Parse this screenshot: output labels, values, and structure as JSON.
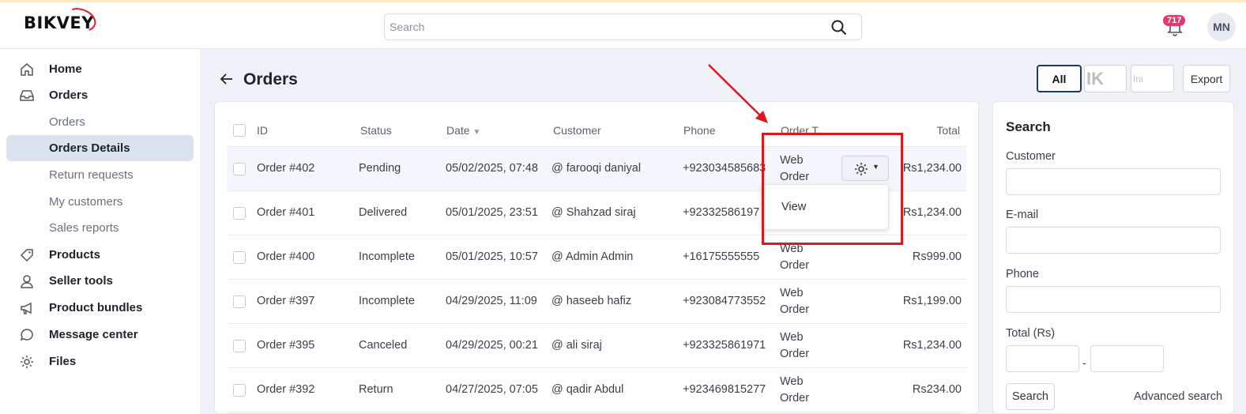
{
  "app": {
    "logo": "BIKVEY",
    "brand_color": "#e31b23"
  },
  "search": {
    "placeholder": "Search"
  },
  "notifications": {
    "count": "717"
  },
  "user": {
    "initials": "MN"
  },
  "sidebar": {
    "items": [
      {
        "label": "Home",
        "icon": "home-icon"
      },
      {
        "label": "Orders",
        "icon": "inbox-icon"
      },
      {
        "label": "Orders"
      },
      {
        "label": "Orders Details",
        "active": true
      },
      {
        "label": "Return requests"
      },
      {
        "label": "My customers"
      },
      {
        "label": "Sales reports"
      },
      {
        "label": "Products",
        "icon": "tag-icon"
      },
      {
        "label": "Seller tools",
        "icon": "user-icon"
      },
      {
        "label": "Product bundles",
        "icon": "megaphone-icon"
      },
      {
        "label": "Message center",
        "icon": "chat-icon"
      },
      {
        "label": "Files",
        "icon": "gear-icon"
      }
    ]
  },
  "page": {
    "title": "Orders"
  },
  "toolbar": {
    "all_label": "All",
    "k_label": "IK",
    "ini_label": "Ini",
    "export_label": "Export"
  },
  "table": {
    "headers": [
      "ID",
      "Status",
      "Date",
      "Customer",
      "Phone",
      "Order T",
      "Total"
    ],
    "rows": [
      {
        "id": "Order #402",
        "status": "Pending",
        "date": "05/02/2025, 07:48",
        "customer": "@ farooqi daniyal",
        "phone": "+923034585683",
        "type1": "Web",
        "type2": "Order",
        "total": "Rs1,234.00"
      },
      {
        "id": "Order #401",
        "status": "Delivered",
        "date": "05/01/2025, 23:51",
        "customer": "@ Shahzad siraj",
        "phone": "+92332586197",
        "type1": "",
        "type2": "",
        "total": "Rs1,234.00"
      },
      {
        "id": "Order #400",
        "status": "Incomplete",
        "date": "05/01/2025, 10:57",
        "customer": "@ Admin Admin",
        "phone": "+16175555555",
        "type1": "Web",
        "type2": "Order",
        "total": "Rs999.00"
      },
      {
        "id": "Order #397",
        "status": "Incomplete",
        "date": "04/29/2025, 11:09",
        "customer": "@ haseeb hafiz",
        "phone": "+923084773552",
        "type1": "Web",
        "type2": "Order",
        "total": "Rs1,199.00"
      },
      {
        "id": "Order #395",
        "status": "Canceled",
        "date": "04/29/2025, 00:21",
        "customer": "@ ali siraj",
        "phone": "+923325861971",
        "type1": "Web",
        "type2": "Order",
        "total": "Rs1,234.00"
      },
      {
        "id": "Order #392",
        "status": "Return",
        "date": "04/27/2025, 07:05",
        "customer": "@ qadir Abdul",
        "phone": "+923469815277",
        "type1": "Web",
        "type2": "Order",
        "total": "Rs234.00"
      }
    ]
  },
  "dropdown": {
    "view_label": "View"
  },
  "filter_panel": {
    "title": "Search",
    "customer_label": "Customer",
    "email_label": "E-mail",
    "phone_label": "Phone",
    "total_label": "Total (Rs)",
    "range_sep": "-",
    "search_button": "Search",
    "advanced_link": "Advanced search"
  }
}
